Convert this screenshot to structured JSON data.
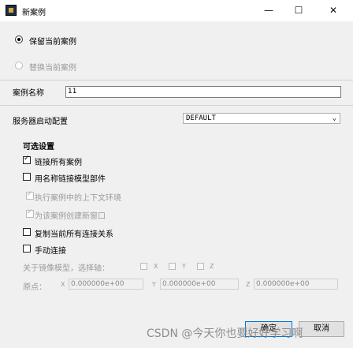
{
  "window": {
    "title": "新案例",
    "minimize": "—",
    "maximize": "☐",
    "close": "✕"
  },
  "mode": {
    "keep_label": "保留当前案例",
    "replace_label": "替换当前案例"
  },
  "case_name": {
    "label": "案例名称",
    "value": "11"
  },
  "solver": {
    "label": "服务器启动配置",
    "selected": "DEFAULT"
  },
  "options": {
    "title": "可选设置",
    "link_all": "链接所有案例",
    "link_named": "用名称链接模型部件",
    "exec_context": "执行案例中的上下文环境",
    "create_window": "为该案例创建新窗口",
    "copy_relations": "复制当前所有连接关系",
    "manual_link": "手动连接",
    "mirror_label": "关于镜像模型，选择轴：",
    "axis_x": "X",
    "axis_y": "Y",
    "axis_z": "Z",
    "origin_label": "原点：",
    "origin_x": "0.000000e+00",
    "origin_y": "0.000000e+00",
    "origin_z": "0.000000e+00"
  },
  "buttons": {
    "ok": "确定",
    "cancel": "取消"
  },
  "watermark": "CSDN @今天你也要好好学习啊"
}
